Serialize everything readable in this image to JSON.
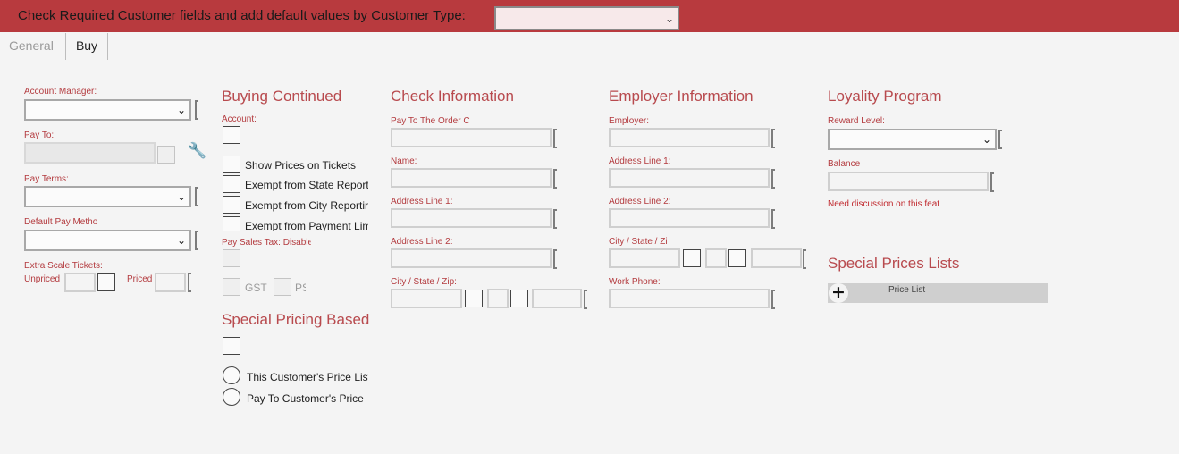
{
  "header": {
    "title": "Check Required Customer fields and add default values by Customer Type:",
    "customer_type_value": ""
  },
  "tabs": [
    {
      "label": "General",
      "active": false
    },
    {
      "label": "Buy",
      "active": true
    }
  ],
  "col1": {
    "account_manager_label": "Account Manager:",
    "pay_to_label": "Pay To:",
    "pay_terms_label": "Pay Terms:",
    "default_pay_method_label": "Default Pay Metho",
    "extra_scale_label": "Extra Scale Tickets:",
    "unpriced_label": "Unpriced",
    "priced_label": "Priced"
  },
  "buying": {
    "heading": "Buying Continued",
    "account_label": "Account:",
    "checkboxes": [
      "Show Prices on Tickets",
      "Exempt from State Report",
      "Exempt from City Reportir",
      "Exempt from Payment Lim"
    ],
    "pay_sales_tax_label": "Pay Sales Tax: Disable",
    "gst_label": "GST",
    "pst_label": "PS"
  },
  "special_pricing": {
    "heading": "Special Pricing Based",
    "radios": [
      "This Customer's Price List",
      "Pay To Customer's Price L"
    ]
  },
  "check_info": {
    "heading": "Check Information",
    "pay_to_order_label": "Pay To The Order C",
    "name_label": "Name:",
    "address1_label": "Address Line 1:",
    "address2_label": "Address Line 2:",
    "city_state_zip_label": "City / State / Zip:"
  },
  "employer": {
    "heading": "Employer Information",
    "employer_label": "Employer:",
    "address1_label": "Address Line 1:",
    "address2_label": "Address Line 2:",
    "city_state_zip_label": "City / State / Zi",
    "work_phone_label": "Work Phone:"
  },
  "loyalty": {
    "heading": "Loyality Program",
    "reward_level_label": "Reward Level:",
    "balance_label": "Balance",
    "note": "Need discussion on this feat"
  },
  "special_prices": {
    "heading": "Special Prices Lists",
    "column_label": "Price List"
  },
  "icons": {
    "dropdown": "chevron-down-icon",
    "pay_to_lookup": "wrench-icon",
    "add_price_list": "plus-icon"
  },
  "colors": {
    "header_bg": "#b83a3e",
    "label_red": "#b33a3e",
    "heading_red": "#b84a4e"
  }
}
